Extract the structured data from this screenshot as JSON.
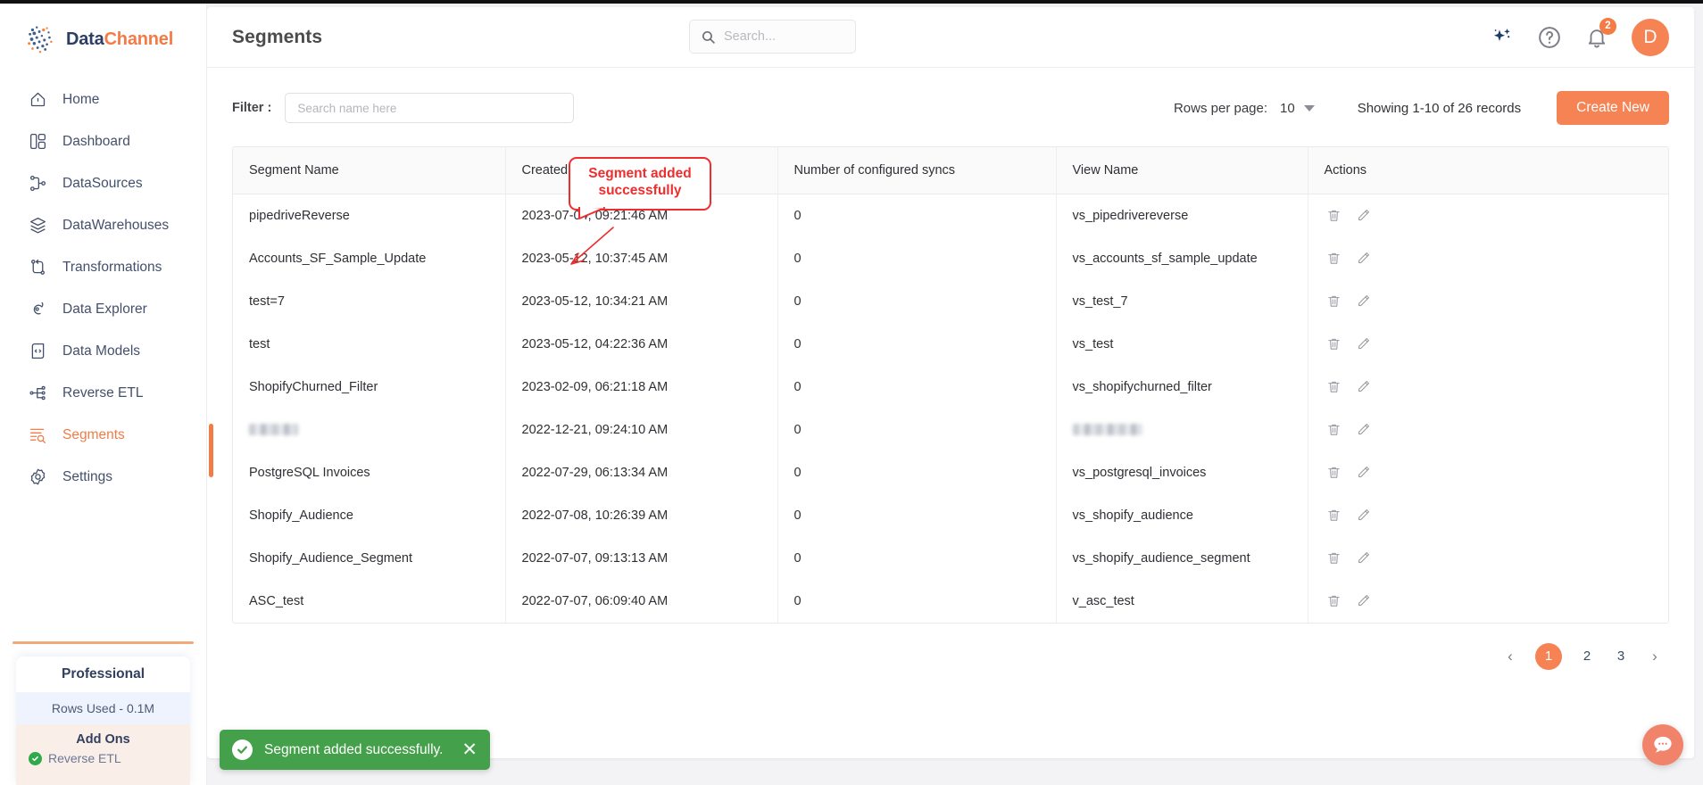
{
  "brand": {
    "part1": "Data",
    "part2": "Channel"
  },
  "sidebar": {
    "items": [
      {
        "label": "Home",
        "icon": "home-icon"
      },
      {
        "label": "Dashboard",
        "icon": "dashboard-icon"
      },
      {
        "label": "DataSources",
        "icon": "datasources-icon"
      },
      {
        "label": "DataWarehouses",
        "icon": "datawarehouses-icon"
      },
      {
        "label": "Transformations",
        "icon": "transformations-icon"
      },
      {
        "label": "Data Explorer",
        "icon": "data-explorer-icon"
      },
      {
        "label": "Data Models",
        "icon": "data-models-icon"
      },
      {
        "label": "Reverse ETL",
        "icon": "reverse-etl-icon"
      },
      {
        "label": "Segments",
        "icon": "segments-icon"
      },
      {
        "label": "Settings",
        "icon": "settings-icon"
      }
    ],
    "active_index": 8,
    "plan": {
      "title": "Professional",
      "rows_used": "Rows Used - 0.1M",
      "addons_heading": "Add Ons",
      "addons": [
        {
          "label": "Reverse ETL"
        }
      ]
    }
  },
  "header": {
    "title": "Segments",
    "search": {
      "value": "",
      "placeholder": "Search..."
    },
    "icons": [
      {
        "name": "ai-sparkle-icon"
      },
      {
        "name": "help-circle-icon"
      },
      {
        "name": "notification-bell-icon",
        "badge": "2"
      }
    ],
    "avatar_initial": "D"
  },
  "toolbar": {
    "filter_label": "Filter :",
    "filter_input": {
      "value": "",
      "placeholder": "Search name here"
    },
    "rows_per_page_label": "Rows per page:",
    "rows_per_page_value": "10",
    "showing_text": "Showing 1-10 of 26 records",
    "create_label": "Create New"
  },
  "table": {
    "columns": [
      "Segment Name",
      "Created On",
      "Number of configured syncs",
      "View Name",
      "Actions"
    ],
    "rows": [
      {
        "name": "pipedriveReverse",
        "created": "2023-07-04, 09:21:46 AM",
        "syncs": "0",
        "view": "vs_pipedrivereverse",
        "redacted": false
      },
      {
        "name": "Accounts_SF_Sample_Update",
        "created": "2023-05-12, 10:37:45 AM",
        "syncs": "0",
        "view": "vs_accounts_sf_sample_update",
        "redacted": false
      },
      {
        "name": "test=7",
        "created": "2023-05-12, 10:34:21 AM",
        "syncs": "0",
        "view": "vs_test_7",
        "redacted": false
      },
      {
        "name": "test",
        "created": "2023-05-12, 04:22:36 AM",
        "syncs": "0",
        "view": "vs_test",
        "redacted": false
      },
      {
        "name": "ShopifyChurned_Filter",
        "created": "2023-02-09, 06:21:18 AM",
        "syncs": "0",
        "view": "vs_shopifychurned_filter",
        "redacted": false
      },
      {
        "name": "",
        "created": "2022-12-21, 09:24:10 AM",
        "syncs": "0",
        "view": "",
        "redacted": true
      },
      {
        "name": "PostgreSQL Invoices",
        "created": "2022-07-29, 06:13:34 AM",
        "syncs": "0",
        "view": "vs_postgresql_invoices",
        "redacted": false
      },
      {
        "name": "Shopify_Audience",
        "created": "2022-07-08, 10:26:39 AM",
        "syncs": "0",
        "view": "vs_shopify_audience",
        "redacted": false
      },
      {
        "name": "Shopify_Audience_Segment",
        "created": "2022-07-07, 09:13:13 AM",
        "syncs": "0",
        "view": "vs_shopify_audience_segment",
        "redacted": false
      },
      {
        "name": "ASC_test",
        "created": "2022-07-07, 06:09:40 AM",
        "syncs": "0",
        "view": "v_asc_test",
        "redacted": false
      }
    ],
    "row_actions": [
      {
        "name": "delete-row-button",
        "icon": "trash-icon"
      },
      {
        "name": "edit-row-button",
        "icon": "pencil-icon"
      }
    ]
  },
  "pagination": {
    "prev": "‹",
    "next": "›",
    "pages": [
      "1",
      "2",
      "3"
    ],
    "active_page": "1"
  },
  "annotation": {
    "line1": "Segment added",
    "line2": "successfully",
    "color": "#ef2d2d"
  },
  "toast": {
    "message": "Segment added successfully.",
    "close_label": "✕",
    "color": "#44a04a"
  },
  "chat": {
    "name": "chat-bubble-icon"
  },
  "colors": {
    "accent": "#f58354",
    "brand_dark": "#2c3e63",
    "success": "#44a04a"
  }
}
